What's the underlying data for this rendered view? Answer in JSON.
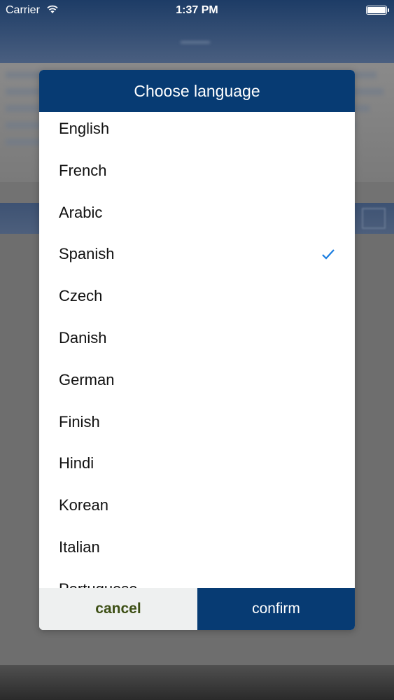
{
  "status_bar": {
    "carrier": "Carrier",
    "time": "1:37 PM"
  },
  "dialog": {
    "title": "Choose language",
    "languages": [
      {
        "label": "English",
        "selected": false
      },
      {
        "label": "French",
        "selected": false
      },
      {
        "label": "Arabic",
        "selected": false
      },
      {
        "label": "Spanish",
        "selected": true
      },
      {
        "label": "Czech",
        "selected": false
      },
      {
        "label": "Danish",
        "selected": false
      },
      {
        "label": "German",
        "selected": false
      },
      {
        "label": "Finish",
        "selected": false
      },
      {
        "label": "Hindi",
        "selected": false
      },
      {
        "label": "Korean",
        "selected": false
      },
      {
        "label": "Italian",
        "selected": false
      },
      {
        "label": "Portuguese",
        "selected": false
      }
    ],
    "cancel_label": "cancel",
    "confirm_label": "confirm"
  },
  "colors": {
    "header_blue": "#073b73",
    "check_blue": "#1a7de0",
    "cancel_text": "#3d4f15"
  }
}
